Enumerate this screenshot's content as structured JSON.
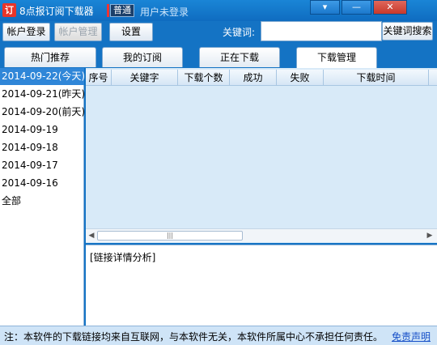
{
  "window": {
    "icon_glyph": "订",
    "title": "8点报订阅下载器",
    "mode_badge": "普通",
    "login_status": "用户未登录",
    "controls": {
      "dropdown": "▾",
      "minimize": "—",
      "close": "✕"
    }
  },
  "toolbar": {
    "account_login": "帐户登录",
    "account_manage": "帐户管理",
    "settings": "设置",
    "keyword_label": "关键词:",
    "keyword_value": "",
    "keyword_search": "关键词搜索"
  },
  "tabs": [
    {
      "label": "热门推荐",
      "active": false
    },
    {
      "label": "我的订阅",
      "active": false
    },
    {
      "label": "正在下载",
      "active": false
    },
    {
      "label": "下载管理",
      "active": true
    }
  ],
  "dates": [
    {
      "label": "2014-09-22(今天)",
      "selected": true
    },
    {
      "label": "2014-09-21(昨天)",
      "selected": false
    },
    {
      "label": "2014-09-20(前天)",
      "selected": false
    },
    {
      "label": "2014-09-19",
      "selected": false
    },
    {
      "label": "2014-09-18",
      "selected": false
    },
    {
      "label": "2014-09-17",
      "selected": false
    },
    {
      "label": "2014-09-16",
      "selected": false
    },
    {
      "label": "全部",
      "selected": false
    }
  ],
  "table": {
    "columns": [
      "序号",
      "关键字",
      "下载个数",
      "成功",
      "失败",
      "下载时间"
    ],
    "rows": []
  },
  "scrollbar": {
    "left_arrow": "◀",
    "right_arrow": "▶",
    "grip": "|||"
  },
  "detail": {
    "text": "[链接详情分析]"
  },
  "footer": {
    "note": "注：本软件的下载链接均来自互联网，与本软件无关，本软件所属中心不承担任何责任。",
    "disclaimer": "免责声明"
  },
  "colors": {
    "frame": "#1473c4",
    "selected_row": "#2f86d8",
    "grid_bg": "#d8eaf8",
    "link": "#1750c8"
  }
}
